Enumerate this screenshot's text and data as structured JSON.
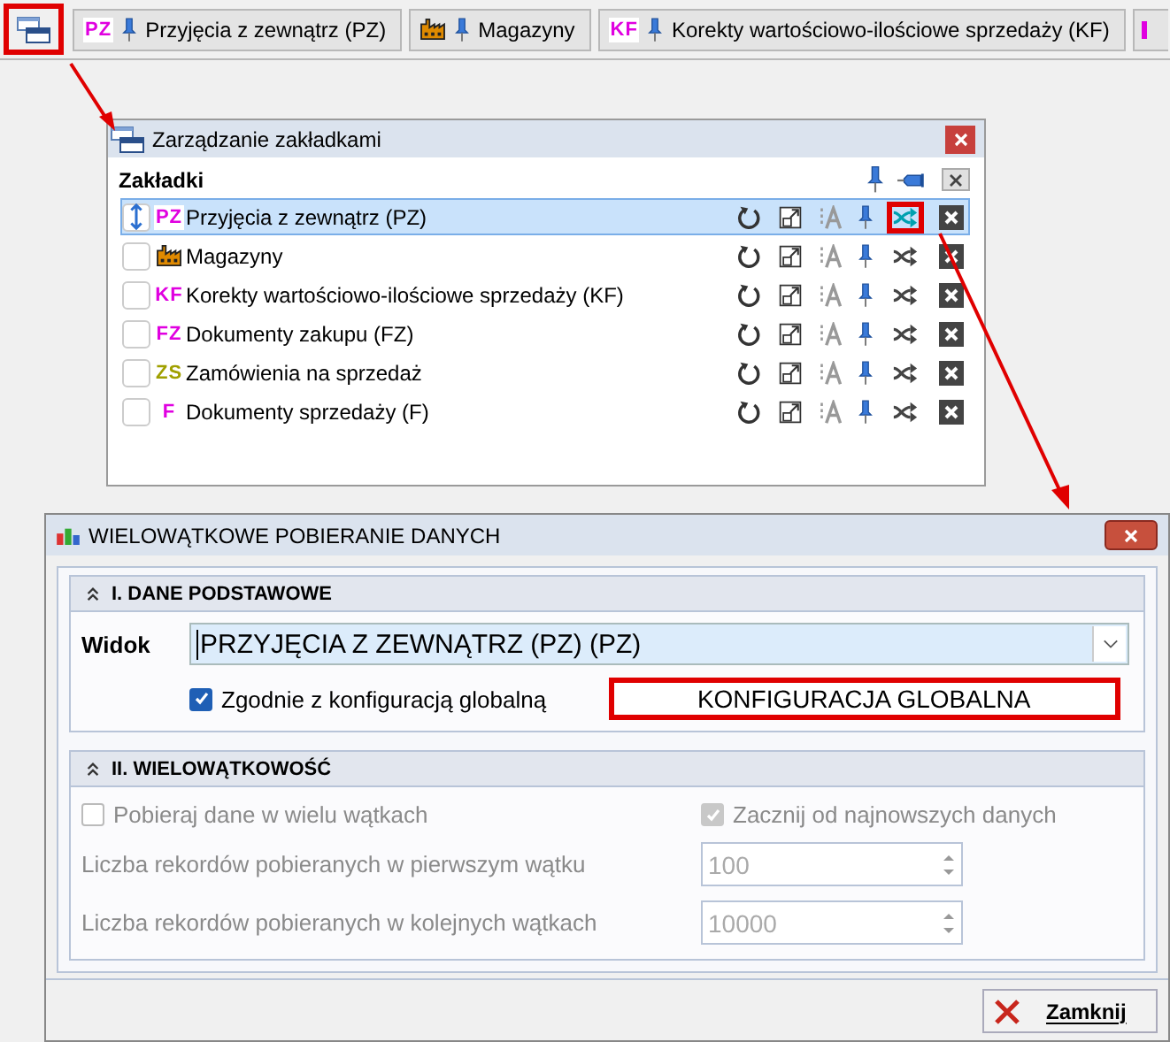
{
  "top_tabs": [
    {
      "kind": "code",
      "code": "PZ",
      "color": "#e000e0",
      "label": "Przyjęcia z zewnątrz (PZ)"
    },
    {
      "kind": "factory",
      "label": "Magazyny"
    },
    {
      "kind": "code",
      "code": "KF",
      "color": "#e000e0",
      "label": "Korekty wartościowo-ilościowe sprzedaży (KF)"
    }
  ],
  "bookmarks_window": {
    "title": "Zarządzanie zakładkami",
    "heading": "Zakładki",
    "rows": [
      {
        "kind": "code",
        "code": "PZ",
        "color": "#e000e0",
        "label": "Przyjęcia z zewnątrz (PZ)",
        "selected": true
      },
      {
        "kind": "factory",
        "label": "Magazyny",
        "selected": false
      },
      {
        "kind": "code",
        "code": "KF",
        "color": "#e000e0",
        "label": "Korekty wartościowo-ilościowe sprzedaży (KF)",
        "selected": false
      },
      {
        "kind": "code",
        "code": "FZ",
        "color": "#e000e0",
        "label": "Dokumenty zakupu (FZ)",
        "selected": false
      },
      {
        "kind": "code",
        "code": "ZS",
        "color": "#a0a000",
        "label": "Zamówienia na sprzedaż",
        "selected": false
      },
      {
        "kind": "code",
        "code": "F",
        "color": "#e000e0",
        "label": "Dokumenty sprzedaży (F)",
        "selected": false
      }
    ]
  },
  "dialog": {
    "title": "WIELOWĄTKOWE POBIERANIE DANYCH",
    "section_1": {
      "title": "I. DANE PODSTAWOWE",
      "expanded": true,
      "view_label": "Widok",
      "view_value": "PRZYJĘCIA Z ZEWNĄTRZ (PZ) (PZ)",
      "global_config": {
        "label": "Zgodnie z konfiguracją globalną",
        "checked": true
      },
      "global_button": "KONFIGURACJA GLOBALNA"
    },
    "section_2": {
      "title": "II. WIELOWĄTKOWOŚĆ",
      "expanded": true,
      "multi_thread": {
        "label": "Pobieraj dane w wielu wątkach",
        "checked": false,
        "disabled": true
      },
      "newest_first": {
        "label": "Zacznij od najnowszych danych",
        "checked": true,
        "disabled": true
      },
      "fields": [
        {
          "label": "Liczba rekordów pobieranych w pierwszym wątku",
          "value": "100",
          "disabled": true
        },
        {
          "label": "Liczba rekordów pobieranych w kolejnych wątkach",
          "value": "10000",
          "disabled": true
        }
      ]
    },
    "close_button": "Zamknij"
  }
}
